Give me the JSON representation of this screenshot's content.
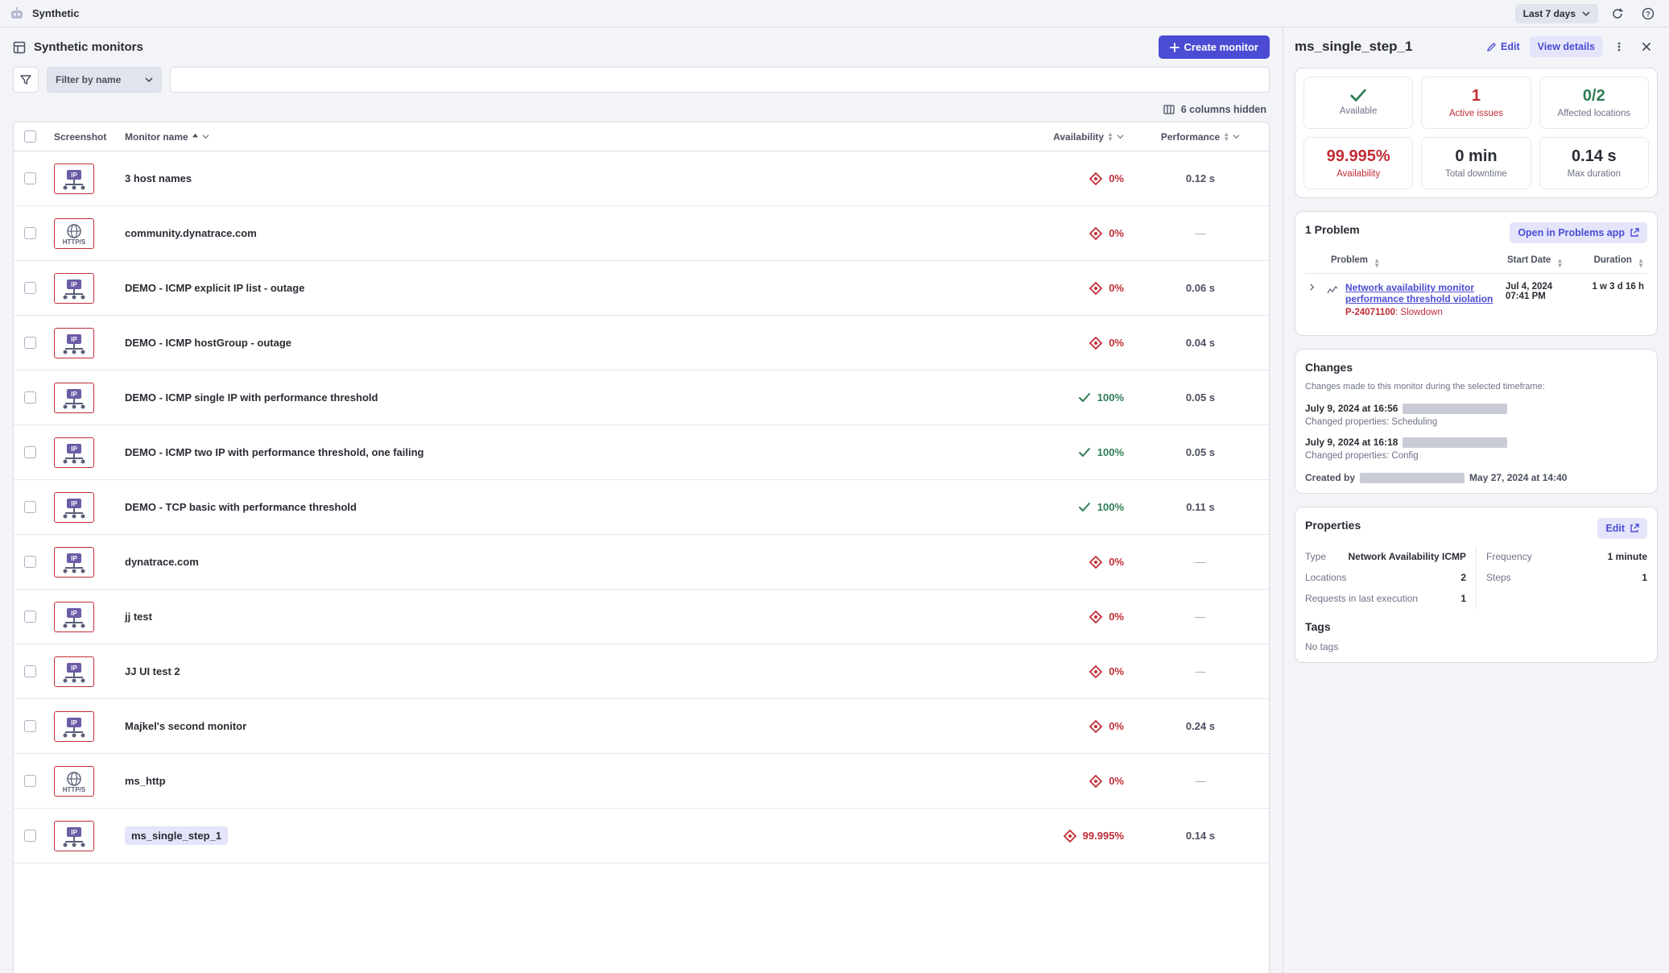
{
  "app": {
    "name": "Synthetic"
  },
  "topbar": {
    "time_range": "Last 7 days"
  },
  "page": {
    "title": "Synthetic monitors",
    "create_button": "Create monitor",
    "filter_label": "Filter by name",
    "columns_hidden": "6 columns hidden"
  },
  "table": {
    "headers": {
      "screenshot": "Screenshot",
      "name": "Monitor name",
      "availability": "Availability",
      "performance": "Performance"
    },
    "rows": [
      {
        "icon": "ip",
        "name": "3 host names",
        "avail": "0%",
        "avail_status": "bad",
        "perf": "0.12 s"
      },
      {
        "icon": "https",
        "name": "community.dynatrace.com",
        "avail": "0%",
        "avail_status": "bad",
        "perf": "—"
      },
      {
        "icon": "ip",
        "name": "DEMO - ICMP explicit IP list - outage",
        "avail": "0%",
        "avail_status": "bad",
        "perf": "0.06 s"
      },
      {
        "icon": "ip",
        "name": "DEMO - ICMP hostGroup - outage",
        "avail": "0%",
        "avail_status": "bad",
        "perf": "0.04 s"
      },
      {
        "icon": "ip",
        "name": "DEMO - ICMP single IP with performance threshold",
        "avail": "100%",
        "avail_status": "good",
        "perf": "0.05 s"
      },
      {
        "icon": "ip",
        "name": "DEMO - ICMP two IP with performance threshold, one failing",
        "avail": "100%",
        "avail_status": "good",
        "perf": "0.05 s"
      },
      {
        "icon": "ip",
        "name": "DEMO - TCP basic with performance threshold",
        "avail": "100%",
        "avail_status": "good",
        "perf": "0.11 s"
      },
      {
        "icon": "ip",
        "name": "dynatrace.com",
        "avail": "0%",
        "avail_status": "bad",
        "perf": "—"
      },
      {
        "icon": "ip",
        "name": "jj test",
        "avail": "0%",
        "avail_status": "bad",
        "perf": "—"
      },
      {
        "icon": "ip",
        "name": "JJ UI test 2",
        "avail": "0%",
        "avail_status": "bad",
        "perf": "—"
      },
      {
        "icon": "ip",
        "name": "Majkel's second monitor",
        "avail": "0%",
        "avail_status": "bad",
        "perf": "0.24 s"
      },
      {
        "icon": "https",
        "name": "ms_http",
        "avail": "0%",
        "avail_status": "bad",
        "perf": "—"
      },
      {
        "icon": "ip",
        "name": "ms_single_step_1",
        "avail": "99.995%",
        "avail_status": "bad",
        "perf": "0.14 s",
        "selected": true
      }
    ]
  },
  "detail": {
    "title": "ms_single_step_1",
    "actions": {
      "edit": "Edit",
      "view": "View details"
    },
    "kpi_top": {
      "available_label": "Available",
      "active_issues_value": "1",
      "active_issues_label": "Active issues",
      "affected_value": "0/2",
      "affected_label": "Affected locations"
    },
    "kpi_bottom": {
      "availability_value": "99.995%",
      "availability_label": "Availability",
      "downtime_value": "0 min",
      "downtime_label": "Total downtime",
      "maxdur_value": "0.14 s",
      "maxdur_label": "Max duration"
    },
    "problems": {
      "heading": "1 Problem",
      "open_label": "Open in Problems app",
      "cols": {
        "problem": "Problem",
        "start": "Start Date",
        "duration": "Duration"
      },
      "items": [
        {
          "title": "Network availability monitor performance threshold violation",
          "id": "P-24071100",
          "kind": "Slowdown",
          "start_date": "Jul 4, 2024",
          "start_time": "07:41 PM",
          "duration": "1 w 3 d 16 h"
        }
      ]
    },
    "changes": {
      "heading": "Changes",
      "note": "Changes made to this monitor during the selected timeframe:",
      "items": [
        {
          "ts": "July 9, 2024 at 16:56",
          "sub_prefix": "Changed properties:",
          "sub_value": "Scheduling"
        },
        {
          "ts": "July 9, 2024 at 16:18",
          "sub_prefix": "Changed properties:",
          "sub_value": "Config"
        }
      ],
      "created_prefix": "Created by",
      "created_ts": "May 27, 2024 at 14:40"
    },
    "properties": {
      "heading": "Properties",
      "edit": "Edit",
      "rows_left": [
        {
          "k": "Type",
          "v": "Network Availability ICMP"
        },
        {
          "k": "Locations",
          "v": "2"
        },
        {
          "k": "Requests in last execution",
          "v": "1"
        }
      ],
      "rows_right": [
        {
          "k": "Frequency",
          "v": "1 minute"
        },
        {
          "k": "Steps",
          "v": "1"
        }
      ]
    },
    "tags": {
      "heading": "Tags",
      "empty": "No tags"
    }
  }
}
